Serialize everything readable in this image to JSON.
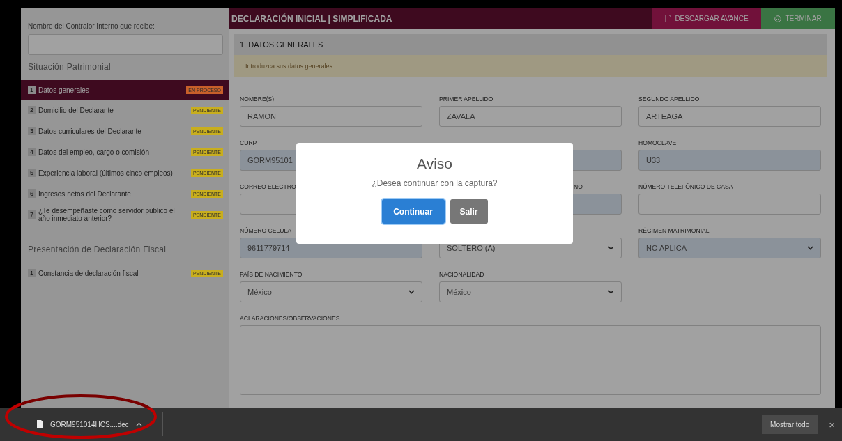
{
  "sidebar": {
    "receiver_label": "Nombre del Contralor Interno que recibe:",
    "sections": [
      {
        "title": "Situación Patrimonial",
        "items": [
          {
            "number": "1",
            "label": "Datos generales",
            "status": "EN PROCESO",
            "color": "#c8602a",
            "selected": true
          },
          {
            "number": "2",
            "label": "Domicilio del Declarante",
            "status": "PENDIENTE",
            "color": "#c8ae1e",
            "selected": false
          },
          {
            "number": "3",
            "label": "Datos curriculares del Declarante",
            "status": "PENDIENTE",
            "color": "#c8ae1e",
            "selected": false
          },
          {
            "number": "4",
            "label": "Datos del empleo, cargo o comisión",
            "status": "PENDIENTE",
            "color": "#c8ae1e",
            "selected": false
          },
          {
            "number": "5",
            "label": "Experiencia laboral (últimos cinco empleos)",
            "status": "PENDIENTE",
            "color": "#c8ae1e",
            "selected": false
          },
          {
            "number": "6",
            "label": "Ingresos netos del Declarante",
            "status": "PENDIENTE",
            "color": "#c8ae1e",
            "selected": false
          },
          {
            "number": "7",
            "label": "¿Te desempeñaste como servidor público el año inmediato anterior?",
            "status": "PENDIENTE",
            "color": "#c8ae1e",
            "selected": false
          }
        ]
      },
      {
        "title": "Presentación de Declaración Fiscal",
        "items": [
          {
            "number": "1",
            "label": "Constancia de declaración fiscal",
            "status": "PENDIENTE",
            "color": "#c8ae1e",
            "selected": false
          }
        ]
      }
    ]
  },
  "header": {
    "title": "DECLARACIÓN INICIAL | SIMPLIFICADA",
    "buttons": [
      {
        "label": "DESCARGAR AVANCE",
        "kind": "download"
      },
      {
        "label": "TERMINAR",
        "kind": "finish"
      }
    ]
  },
  "section": {
    "title": "1. DATOS GENERALES",
    "notice": "Introduzca sus datos generales."
  },
  "rows": [
    [
      {
        "label": "NOMBRE(S)",
        "kind": "input",
        "value": "RAMON",
        "highlighted": false
      },
      {
        "label": "PRIMER APELLIDO",
        "kind": "input",
        "value": "ZAVALA",
        "highlighted": false
      },
      {
        "label": "SEGUNDO APELLIDO",
        "kind": "input",
        "value": "ARTEAGA",
        "highlighted": false
      }
    ],
    [
      {
        "label": "CURP",
        "kind": "input",
        "value": "GORM95101",
        "highlighted": true
      },
      {
        "kind": "input",
        "highlighted": true
      },
      {
        "label": "HOMOCLAVE",
        "kind": "input",
        "value": "U33",
        "highlighted": true
      }
    ],
    [
      {
        "label": "CORREO ELECTRO",
        "kind": "input",
        "highlighted": false
      },
      {
        "label": "NO",
        "label_clipped": true,
        "kind": "input",
        "highlighted": true
      },
      {
        "label": "NÚMERO TELEFÓNICO DE CASA",
        "kind": "input",
        "highlighted": false
      }
    ],
    [
      {
        "label": "NÚMERO CELULA",
        "kind": "input",
        "value": "9611779714",
        "highlighted": true
      },
      {
        "kind": "select",
        "value": "SOLTERO (A)",
        "highlighted": false
      },
      {
        "label": "RÉGIMEN MATRIMONIAL",
        "kind": "select",
        "value": "NO APLICA",
        "highlighted": true
      }
    ],
    [
      {
        "label": "PAÍS DE NACIMIENTO",
        "kind": "select",
        "value": "México",
        "highlighted": false
      },
      {
        "label": "NACIONALIDAD",
        "kind": "select",
        "value": "México",
        "highlighted": false
      }
    ],
    [
      {
        "label": "ACLARACIONES/OBSERVACIONES",
        "kind": "textarea",
        "highlighted": false
      }
    ]
  ],
  "dialog": {
    "title": "Aviso",
    "message": "¿Desea continuar con la captura?",
    "buttons": [
      {
        "label": "Continuar",
        "kind": "primary"
      },
      {
        "label": "Salir",
        "kind": "secondary"
      }
    ]
  },
  "download_bar": {
    "file": "GORM951014HCS....dec",
    "show_all": "Mostrar todo",
    "close": "×"
  }
}
